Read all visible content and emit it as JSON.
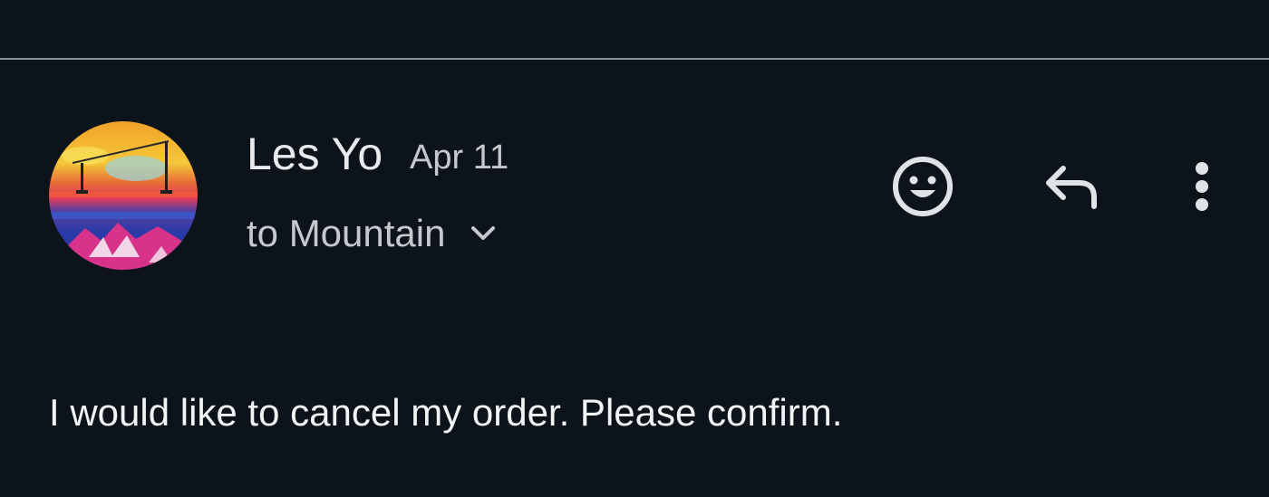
{
  "message": {
    "sender_name": "Les Yo",
    "date": "Apr 11",
    "recipients_label": "to Mountain",
    "body": "I would like to cancel my order. Please confirm."
  },
  "icons": {
    "avatar": "painted-sunset-avatar",
    "recipients_toggle": "chevron-down-icon",
    "emoji": "smiley-icon",
    "reply": "reply-arrow-icon",
    "more": "more-vert-icon"
  },
  "colors": {
    "background": "#0c131a",
    "text_primary": "#e8eaed",
    "text_secondary": "#c5c8cc",
    "icon": "#e0e3e6",
    "divider": "#8a8f94"
  }
}
